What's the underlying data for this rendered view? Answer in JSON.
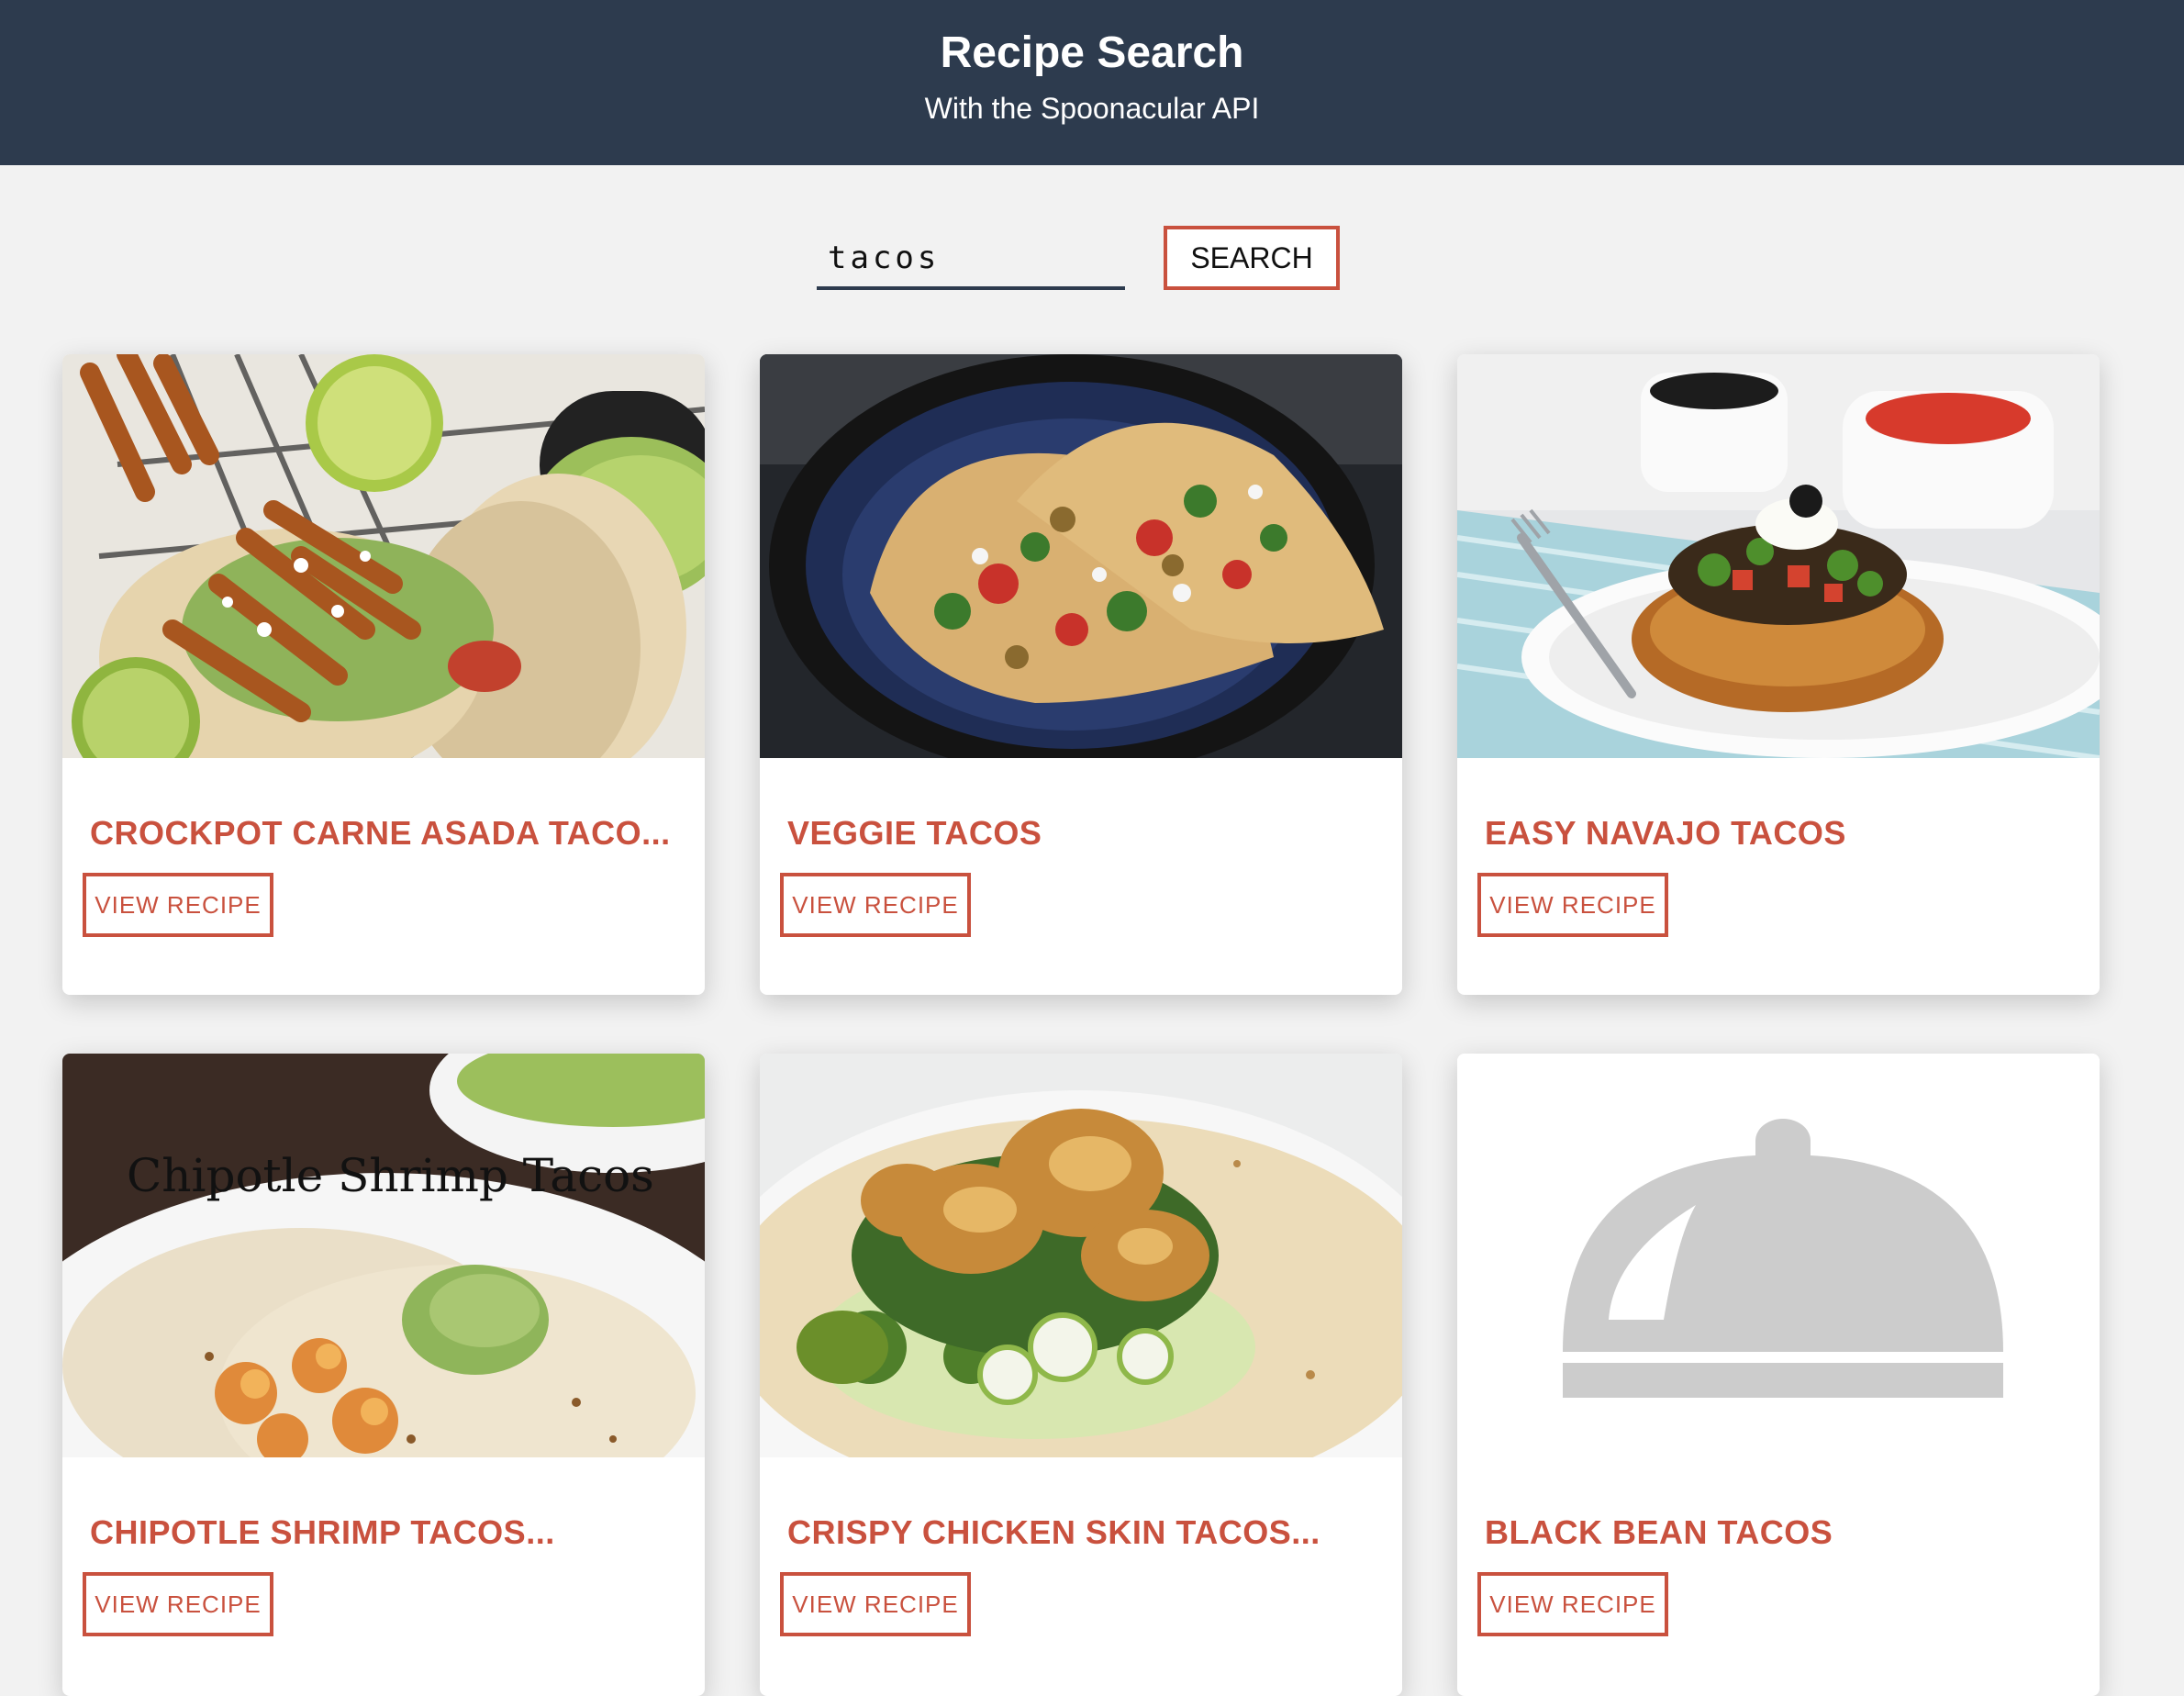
{
  "header": {
    "title": "Recipe Search",
    "subtitle": "With the Spoonacular API"
  },
  "search": {
    "query": "tacos",
    "button_label": "SEARCH"
  },
  "results": [
    {
      "name": "CROCKPOT CARNE ASADA TACO...",
      "button_label": "VIEW RECIPE",
      "image": "tacos-with-fries-photo"
    },
    {
      "name": "VEGGIE TACOS",
      "button_label": "VIEW RECIPE",
      "image": "veggie-tacos-photo"
    },
    {
      "name": "EASY NAVAJO TACOS",
      "button_label": "VIEW RECIPE",
      "image": "navajo-taco-photo"
    },
    {
      "name": "CHIPOTLE SHRIMP TACOS...",
      "button_label": "VIEW RECIPE",
      "image": "shrimp-tacos-photo",
      "image_caption": "Chipotle Shrimp Tacos"
    },
    {
      "name": "CRISPY CHICKEN SKIN TACOS...",
      "button_label": "VIEW RECIPE",
      "image": "chicken-skin-taco-photo"
    },
    {
      "name": "BLACK BEAN TACOS",
      "button_label": "VIEW RECIPE",
      "image": "cloche-placeholder-icon"
    }
  ],
  "colors": {
    "header_bg": "#2d3b4e",
    "accent": "#c9513e",
    "page_bg": "#f2f2f2",
    "placeholder_gray": "#cccccc"
  }
}
